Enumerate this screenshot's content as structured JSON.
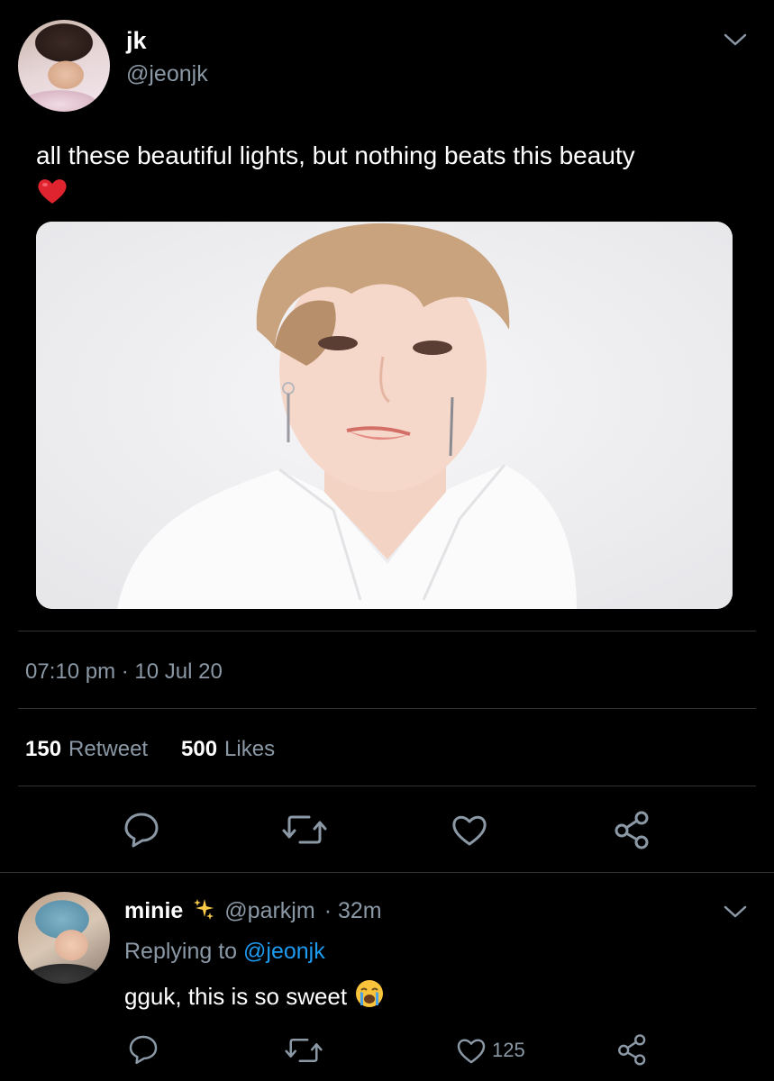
{
  "main_tweet": {
    "author_name": "jk",
    "author_handle": "@jeonjk",
    "text": "all these beautiful lights, but nothing beats this beauty",
    "timestamp": "07:10 pm · 10 Jul 20",
    "stats": {
      "retweet_count": "150",
      "retweet_label": "Retweet",
      "likes_count": "500",
      "likes_label": "Likes"
    }
  },
  "reply": {
    "author_name": "minie",
    "author_handle": "@parkjm",
    "time": "· 32m",
    "replying_label": "Replying to",
    "replying_handle": "@jeonjk",
    "text": "gguk, this is so sweet",
    "like_count": "125"
  },
  "colors": {
    "background": "#000000",
    "secondary_text": "#8b98a5",
    "link": "#1d9bf0",
    "divider": "#2f3336"
  },
  "icons": [
    "chevron-down-icon",
    "heart-emoji-icon",
    "reply-icon",
    "retweet-icon",
    "like-icon",
    "share-icon",
    "sparkles-emoji-icon",
    "crying-emoji-icon"
  ]
}
